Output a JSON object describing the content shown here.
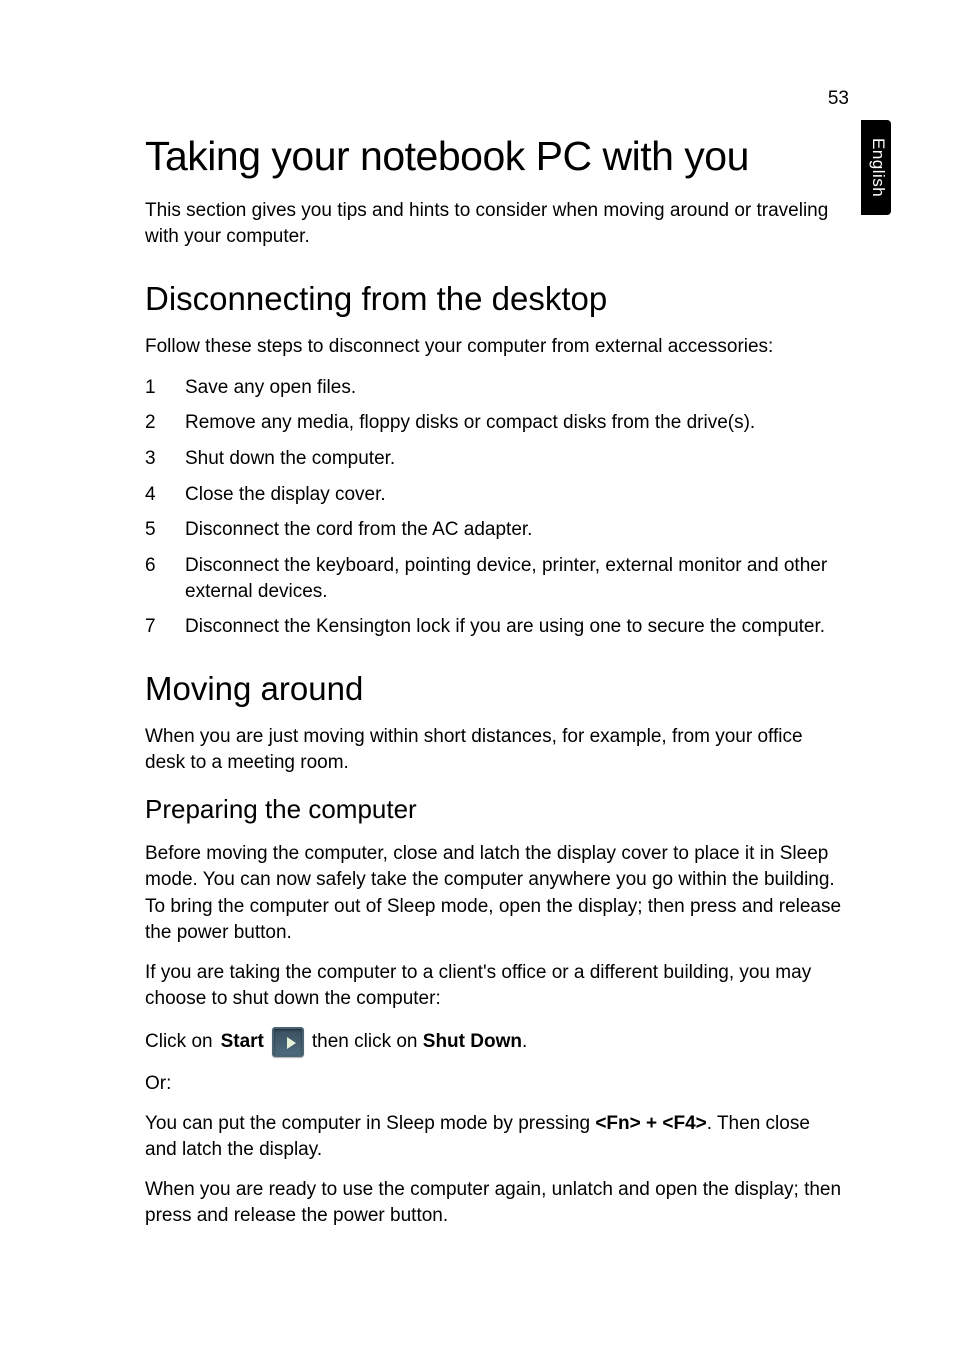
{
  "page_number": "53",
  "language_tab": "English",
  "title_h1": "Taking your notebook PC with you",
  "intro_p": "This section gives you tips and hints to consider when moving around or traveling with your computer.",
  "h2_disconnecting": "Disconnecting from the desktop",
  "disconnecting_intro": "Follow these steps to disconnect your computer from external accessories:",
  "steps": [
    {
      "num": "1",
      "text": "Save any open files."
    },
    {
      "num": "2",
      "text": "Remove any media, floppy disks or compact disks from the drive(s)."
    },
    {
      "num": "3",
      "text": "Shut down the computer."
    },
    {
      "num": "4",
      "text": "Close the display cover."
    },
    {
      "num": "5",
      "text": "Disconnect the cord from the AC adapter."
    },
    {
      "num": "6",
      "text": "Disconnect the keyboard, pointing device, printer, external monitor and other external devices."
    },
    {
      "num": "7",
      "text": "Disconnect the Kensington lock if you are using one to secure the computer."
    }
  ],
  "h2_moving": "Moving around",
  "moving_intro": "When you are just moving within short distances, for example, from your office desk to a meeting room.",
  "h3_preparing": "Preparing the computer",
  "preparing_p1": "Before moving the computer, close and latch the display cover to place it in Sleep mode. You can now safely take the computer anywhere you go within the building. To bring the computer out of Sleep mode, open the display; then press and release the power button.",
  "preparing_p2": "If you are taking the computer to a client's office or a different building, you may choose to shut down the computer:",
  "click_prefix": "Click on ",
  "click_start_bold": "Start",
  "click_mid": " then click on ",
  "click_shutdown_bold": "Shut Down",
  "click_suffix": ".",
  "or_label": "Or:",
  "sleep_p_prefix": "You can put the computer in Sleep mode by pressing ",
  "sleep_key1": "<Fn> + <F4>",
  "sleep_p_suffix": ". Then close and latch the display.",
  "ready_p": "When you are ready to use the computer again, unlatch and open the display; then press and release the power button."
}
